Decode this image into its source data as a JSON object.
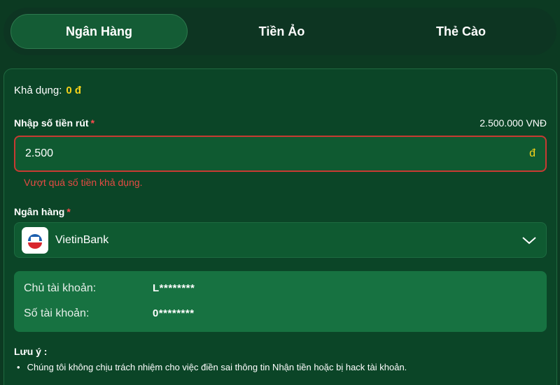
{
  "tabs": [
    {
      "label": "Ngân Hàng",
      "active": true
    },
    {
      "label": "Tiền Ảo",
      "active": false
    },
    {
      "label": "Thẻ Cào",
      "active": false
    }
  ],
  "available": {
    "label": "Khả dụng:",
    "amount": "0 đ"
  },
  "withdraw": {
    "label": "Nhập số tiền rút",
    "required_mark": "*",
    "max_amount": "2.500.000 VNĐ",
    "value": "2.500",
    "currency": "đ",
    "error": "Vượt quá số tiền khả dụng."
  },
  "bank": {
    "label": "Ngân hàng",
    "required_mark": "*",
    "selected": "VietinBank",
    "icon": "chevron-down-icon"
  },
  "account": {
    "holder_label": "Chủ tài khoản:",
    "holder_value": "L********",
    "number_label": "Số tài khoản:",
    "number_value": "0********"
  },
  "note": {
    "title": "Lưu ý :",
    "items": [
      "Chúng tôi không chịu trách nhiệm cho việc điền sai thông tin Nhận tiền hoặc bị hack tài khoản."
    ]
  },
  "colors": {
    "background": "#0c3a22",
    "accent_yellow": "#f5d21b",
    "error_red": "#e54b43",
    "account_box": "#177241"
  }
}
